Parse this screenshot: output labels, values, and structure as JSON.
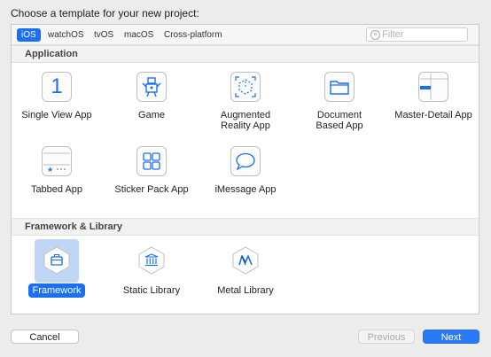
{
  "heading": "Choose a template for your new project:",
  "tabs": [
    {
      "label": "iOS",
      "active": true
    },
    {
      "label": "watchOS",
      "active": false
    },
    {
      "label": "tvOS",
      "active": false
    },
    {
      "label": "macOS",
      "active": false
    },
    {
      "label": "Cross-platform",
      "active": false
    }
  ],
  "filter": {
    "placeholder": "Filter",
    "value": "",
    "icon": "filter-icon"
  },
  "sections": [
    {
      "title": "Application",
      "templates": [
        {
          "label": "Single View App",
          "icon": "single-view-icon"
        },
        {
          "label": "Game",
          "icon": "game-icon"
        },
        {
          "label": "Augmented Reality App",
          "label_lines": [
            "Augmented",
            "Reality App"
          ],
          "icon": "ar-icon"
        },
        {
          "label": "Document Based App",
          "label_lines": [
            "Document",
            "Based App"
          ],
          "icon": "folder-icon"
        },
        {
          "label": "Master-Detail App",
          "icon": "master-detail-icon"
        },
        {
          "label": "Tabbed App",
          "icon": "tabbed-icon"
        },
        {
          "label": "Sticker Pack App",
          "icon": "sticker-grid-icon"
        },
        {
          "label": "iMessage App",
          "icon": "message-bubble-icon"
        }
      ]
    },
    {
      "title": "Framework & Library",
      "templates": [
        {
          "label": "Framework",
          "icon": "framework-hexagon-icon",
          "selected": true
        },
        {
          "label": "Static Library",
          "icon": "static-library-hexagon-icon"
        },
        {
          "label": "Metal Library",
          "icon": "metal-library-hexagon-icon"
        }
      ]
    }
  ],
  "icon_glyphs": {
    "single-view": "1"
  },
  "buttons": {
    "cancel": "Cancel",
    "previous": "Previous",
    "next": "Next"
  },
  "colors": {
    "accent": "#1b6ff3",
    "selection": "#bfd6f6"
  }
}
